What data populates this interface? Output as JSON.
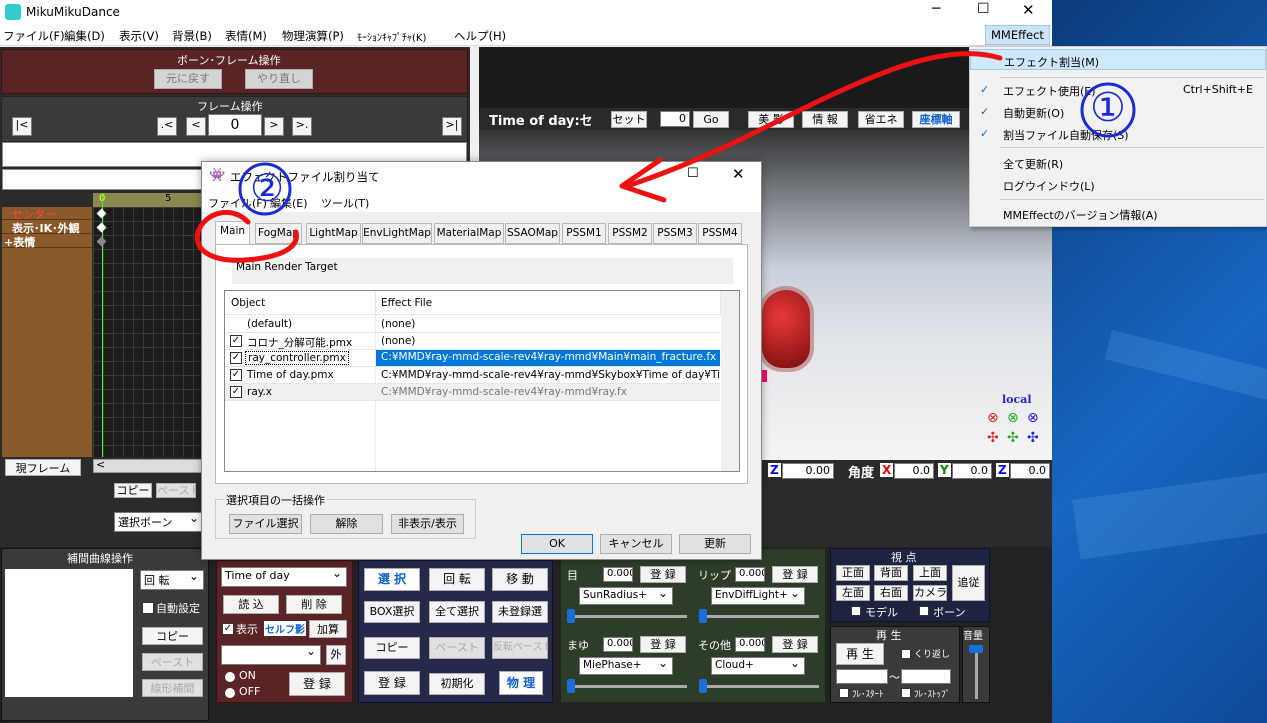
{
  "app": {
    "title": "MikuMikuDance",
    "mmeffect_menu": "MMEffect"
  },
  "menubar": [
    "ファイル(F)",
    "編集(D)",
    "表示(V)",
    "背景(B)",
    "表情(M)",
    "物理演算(P)",
    "ﾓｰｼｮﾝｷｬﾌﾟﾁｬ(K)",
    "ヘルプ(H)"
  ],
  "bone_panel": {
    "title": "ボーン･フレーム操作",
    "undo": "元に戻す",
    "redo": "やり直し",
    "frame_title": "フレーム操作",
    "frame_value": "0",
    "nav": [
      "|<",
      ".<",
      "<",
      ">",
      ">.",
      ">|"
    ]
  },
  "timeline": {
    "ticks": [
      "0",
      "5"
    ],
    "tracks": [
      "センター",
      "表示･IK･外観",
      "+表情"
    ],
    "current_frame_btn": "現フレーム",
    "copy": "コピー",
    "paste": "ペースト",
    "select_bone": "選択ボーン"
  },
  "viewport": {
    "label": "Time of day:セ",
    "set": "セット",
    "frame": "0",
    "go": "Go",
    "btns": [
      "美 影",
      "情 報",
      "省エネ",
      "座標軸"
    ],
    "local": "local",
    "z_label": "Z",
    "z_val": "0.00",
    "angle_label": "角度",
    "ax": "X",
    "ax_val": "0.0",
    "ay": "Y",
    "ay_val": "0.0",
    "az": "Z",
    "az_val": "0.0"
  },
  "dialog": {
    "title": "エフェクトファイル割り当て",
    "menu": [
      "ファイル(F)",
      "編集(E)",
      "ツール(T)"
    ],
    "tabs": [
      "Main",
      "FogMap",
      "LightMap",
      "EnvLightMap",
      "MaterialMap",
      "SSAOMap",
      "PSSM1",
      "PSSM2",
      "PSSM3",
      "PSSM4"
    ],
    "render_target": "Main Render Target",
    "col_object": "Object",
    "col_effect": "Effect File",
    "rows": [
      {
        "object": "(default)",
        "effect": "(none)",
        "check": false
      },
      {
        "object": "コロナ_分解可能.pmx",
        "effect": "(none)",
        "check": true
      },
      {
        "object": "ray_controller.pmx",
        "effect": "C:¥MMD¥ray-mmd-scale-rev4¥ray-mmd¥Main¥main_fracture.fx",
        "check": true
      },
      {
        "object": "Time of day.pmx",
        "effect": "C:¥MMD¥ray-mmd-scale-rev4¥ray-mmd¥Skybox¥Time of day¥Time...",
        "check": true
      },
      {
        "object": "ray.x",
        "effect": "C:¥MMD¥ray-mmd-scale-rev4¥ray-mmd¥ray.fx",
        "check": true
      }
    ],
    "batch_label": "選択項目の一括操作",
    "file_select": "ファイル選択",
    "release": "解除",
    "hide_show": "非表示/表示",
    "ok": "OK",
    "cancel": "キャンセル",
    "update": "更新"
  },
  "dropdown": {
    "items": [
      {
        "label": "エフェクト割当(M)",
        "shortcut": "",
        "check": false
      },
      {
        "label": "エフェクト使用(E)",
        "shortcut": "Ctrl+Shift+E",
        "check": true
      },
      {
        "label": "自動更新(O)",
        "shortcut": "",
        "check": true
      },
      {
        "label": "割当ファイル自動保存(S)",
        "shortcut": "",
        "check": true
      },
      {
        "label": "全て更新(R)",
        "shortcut": "",
        "check": false
      },
      {
        "label": "ログウインドウ(L)",
        "shortcut": "",
        "check": false
      },
      {
        "label": "MMEffectのバージョン情報(A)",
        "shortcut": "",
        "check": false
      }
    ]
  },
  "annotations": {
    "one": "①",
    "two": "②"
  },
  "interp": {
    "title": "補間曲線操作",
    "rot": "回 転",
    "auto": "自動設定",
    "copy": "コピー",
    "paste": "ペースト",
    "linear": "線形補間"
  },
  "model": {
    "select": "Time of day",
    "load": "読 込",
    "delete": "削 除",
    "show": "表示",
    "self_shadow": "セルフ影",
    "add": "加算",
    "outer": "外",
    "on": "ON",
    "off": "OFF",
    "register": "登 録"
  },
  "bone_ops": {
    "select": "選 択",
    "rotate": "回 転",
    "move": "移 動",
    "box": "BOX選択",
    "all": "全て選択",
    "unreg": "未登録選",
    "copy": "コピー",
    "paste": "ペースト",
    "rev_paste": "反転ペースト",
    "register": "登 録",
    "init": "初期化",
    "physics": "物 理"
  },
  "morph": {
    "eye": "目",
    "eye_val": "0.000",
    "eye_sel": "SunRadius+",
    "lip": "リップ",
    "lip_val": "0.000",
    "lip_sel": "EnvDiffLight+",
    "brow": "まゆ",
    "brow_val": "0.000",
    "brow_sel": "MiePhase+",
    "other": "その他",
    "other_val": "0.000",
    "other_sel": "Cloud+",
    "register": "登 録"
  },
  "viewpoint": {
    "title": "視 点",
    "front": "正面",
    "back": "背面",
    "top": "上面",
    "left": "左面",
    "right": "右面",
    "camera": "カメラ",
    "follow": "追従",
    "model": "モデル",
    "bone": "ボーン"
  },
  "playback": {
    "title": "再 生",
    "play": "再 生",
    "loop": "くり返し",
    "start": "ﾌﾚ･ｽﾀｰﾄ",
    "stop": "ﾌﾚ･ｽﾄｯﾌﾟ",
    "tilde": "～",
    "volume": "音量"
  }
}
